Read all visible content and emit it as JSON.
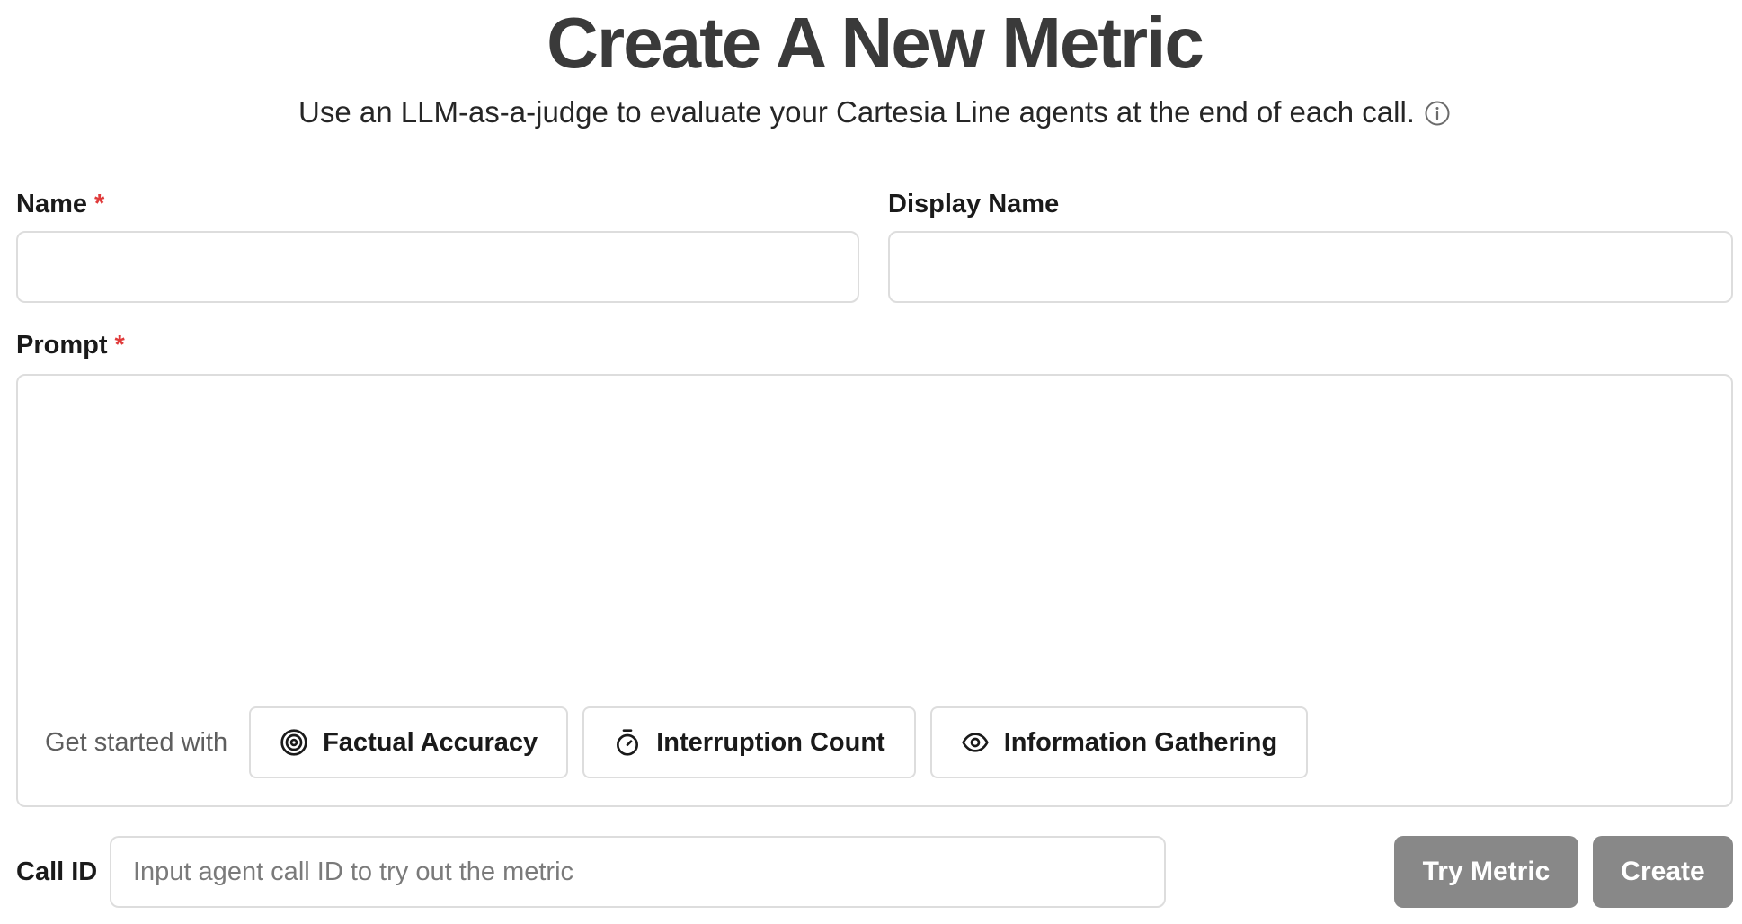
{
  "header": {
    "title": "Create A New Metric",
    "subtitle": "Use an LLM-as-a-judge to evaluate your Cartesia Line agents at the end of each call."
  },
  "form": {
    "name": {
      "label": "Name",
      "required_mark": "*",
      "value": ""
    },
    "display_name": {
      "label": "Display Name",
      "value": ""
    },
    "prompt": {
      "label": "Prompt",
      "required_mark": "*",
      "value": "",
      "starter_text": "Get started with",
      "templates": [
        {
          "label": "Factual Accuracy",
          "icon": "target-icon"
        },
        {
          "label": "Interruption Count",
          "icon": "stopwatch-icon"
        },
        {
          "label": "Information Gathering",
          "icon": "eye-icon"
        }
      ]
    },
    "call_id": {
      "label": "Call ID",
      "value": "",
      "placeholder": "Input agent call ID to try out the metric"
    }
  },
  "actions": {
    "try_metric": "Try Metric",
    "create": "Create"
  },
  "colors": {
    "required": "#e03a3a",
    "button_disabled": "#888888",
    "border": "#dddddd",
    "title": "#3a3a3a"
  }
}
